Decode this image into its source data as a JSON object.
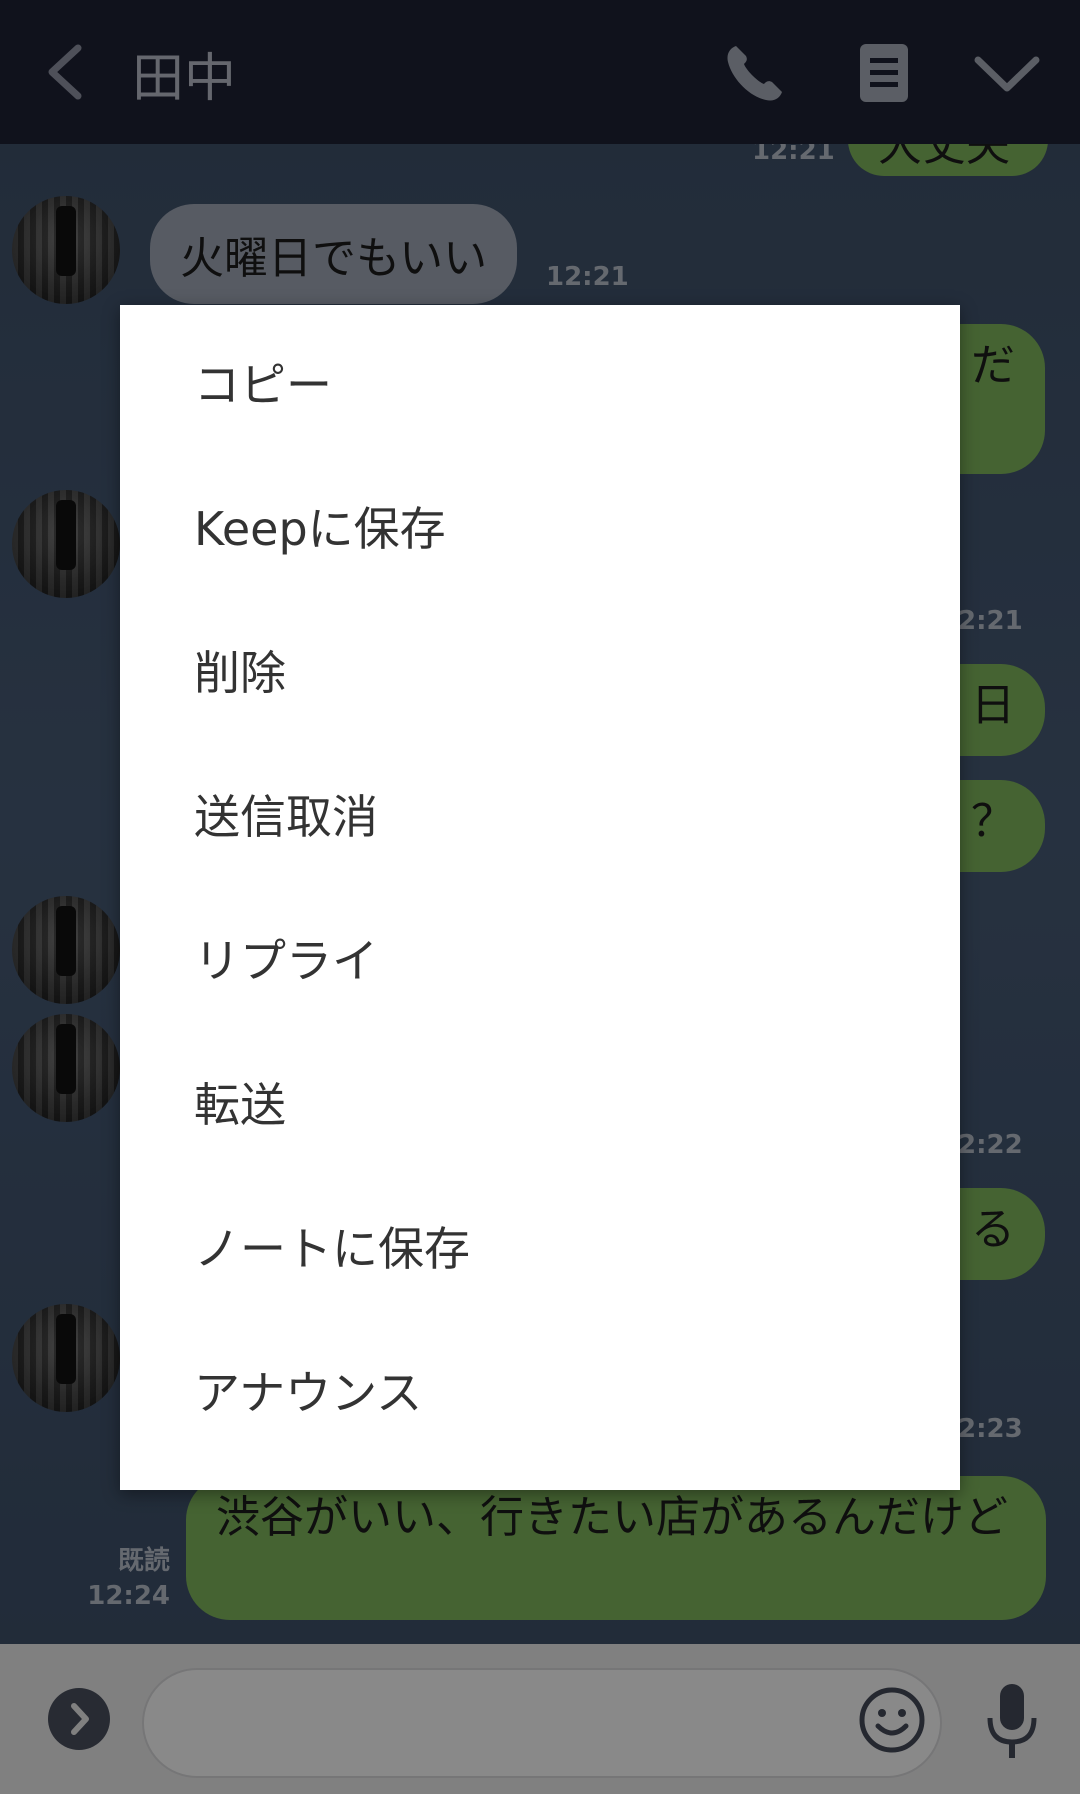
{
  "header": {
    "back_label": "",
    "title": "田中"
  },
  "messages": {
    "top_out_fragment": "大丈夫",
    "top_out_time": "12:21",
    "in_1_text": "火曜日でもいい",
    "in_1_time": "12:21",
    "out_frag_1": "だ",
    "out_time_frag_1": "2:21",
    "out_frag_2": "日",
    "out_frag_3": "？",
    "out_time_frag_2": "2:22",
    "out_frag_4": "る",
    "out_time_frag_3": "2:23",
    "last_out_text": "渋谷がいい、行きたい店があるんだけど",
    "last_out_read": "既読",
    "last_out_time": "12:24"
  },
  "menu": {
    "items": [
      {
        "label": "コピー"
      },
      {
        "label": "Keepに保存"
      },
      {
        "label": "削除"
      },
      {
        "label": "送信取消"
      },
      {
        "label": "リプライ"
      },
      {
        "label": "転送"
      },
      {
        "label": "ノートに保存"
      },
      {
        "label": "アナウンス"
      }
    ]
  },
  "input": {
    "placeholder": ""
  },
  "colors": {
    "header_bg": "#1e2133",
    "chat_bg": "#3f5169",
    "outgoing_bubble": "#7fb55b",
    "incoming_bubble": "#9ea6b4",
    "menu_bg": "#ffffff"
  }
}
